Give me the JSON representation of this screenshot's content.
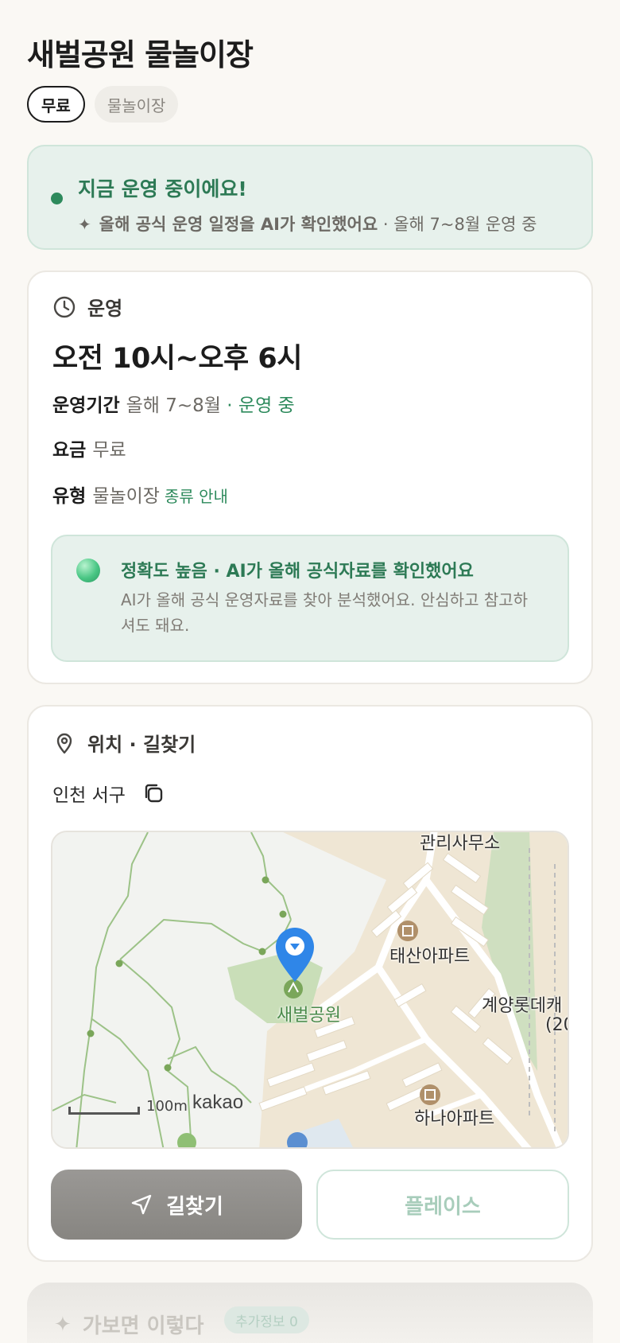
{
  "title": "새벌공원 물놀이장",
  "chips": [
    "무료",
    "물놀이장"
  ],
  "status": {
    "headline": "지금 운영 중이에요!",
    "sub_strong": "올해 공식 운영 일정을 AI가 확인했어요",
    "sub_rest": " · 올해 7~8월 운영 중"
  },
  "operation": {
    "section_label": "운영",
    "hours": "오전 10시~오후 6시",
    "period_label": "운영기간",
    "period_value": "올해 7~8월",
    "period_status": " · 운영 중",
    "fee_label": "요금",
    "fee_value": "무료",
    "type_label": "유형",
    "type_value": "물놀이장",
    "type_link": "종류 안내",
    "ai_title": "정확도 높음 · AI가 올해 공식자료를 확인했어요",
    "ai_desc": "AI가 올해 공식 운영자료를 찾아 분석했어요. 안심하고 참고하셔도 돼요."
  },
  "location": {
    "section_label": "위치 · 길찾기",
    "address": "인천 서구",
    "map_labels": {
      "office": "관리사무소",
      "apt1": "태산아파트",
      "apt2": "하나아파트",
      "park": "새벌공원",
      "right": "계양롯데캐",
      "right2": "(20"
    },
    "scale": "100m",
    "brand": "kakao",
    "directions_button": "길찾기",
    "places_button": "플레이스"
  },
  "next_section": {
    "title": "가보면 이렇다",
    "badge": "추가정보 0"
  },
  "colors": {
    "accent_green": "#2d8a5c",
    "pin_blue": "#2f86e8"
  }
}
